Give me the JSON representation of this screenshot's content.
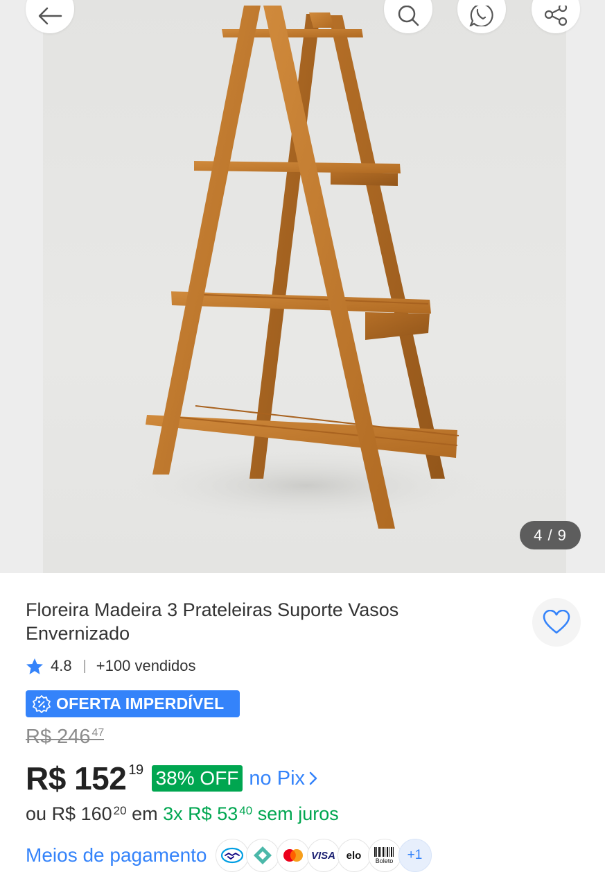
{
  "gallery": {
    "counter": "4 / 9",
    "product_image_alt": "Floreira de madeira com 3 prateleiras",
    "buttons": {
      "back": "arrow-left-icon",
      "search": "search-icon",
      "whatsapp": "whatsapp-icon",
      "share": "share-icon"
    }
  },
  "product": {
    "title": "Floreira Madeira 3 Prateleiras Suporte Vasos Envernizado",
    "rating": "4.8",
    "sold": "+100 vendidos",
    "badge": "OFERTA IMPERDÍVEL",
    "old_price": {
      "currency": "R$",
      "integer": "246",
      "cents": "47"
    },
    "price": {
      "currency": "R$",
      "integer": "152",
      "cents": "19"
    },
    "discount": "38% OFF",
    "pix": "no Pix",
    "installments": {
      "prefix": "ou",
      "total_currency": "R$",
      "total_integer": "160",
      "total_cents": "20",
      "connector": "em",
      "count": "3x",
      "value_currency": "R$",
      "value_integer": "53",
      "value_cents": "40",
      "suffix": "sem juros"
    }
  },
  "payment": {
    "label": "Meios de pagamento",
    "methods": [
      "mercado-pago-icon",
      "pix-icon",
      "mastercard-icon",
      "VISA",
      "elo",
      "Boleto"
    ],
    "visa": "VISA",
    "elo": "elo",
    "boleto": "Boleto",
    "more": "+1"
  },
  "colors": {
    "accent": "#3483fa",
    "green": "#00a650",
    "wood": "#c47a2c",
    "counter_bg": "#5d5d5d"
  }
}
